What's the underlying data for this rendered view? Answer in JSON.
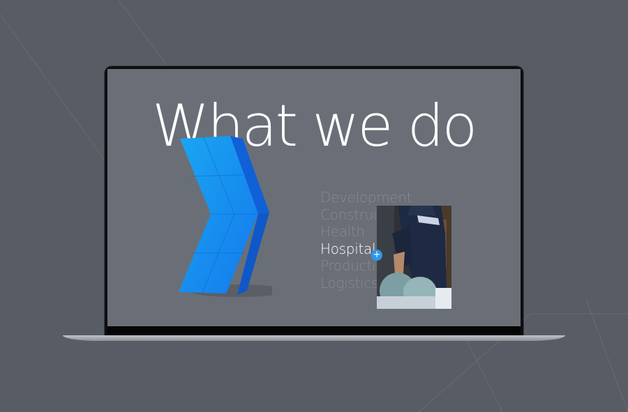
{
  "page": {
    "headline": "What we do",
    "services": [
      {
        "label": "Development",
        "active": false
      },
      {
        "label": "Construction",
        "active": false
      },
      {
        "label": "Health",
        "active": false
      },
      {
        "label": "Hospitality",
        "active": true
      },
      {
        "label": "Production",
        "active": false
      },
      {
        "label": "Logistics",
        "active": false
      }
    ],
    "cursor_symbol": "+"
  },
  "icons": {
    "logo": "chevron-arrow-icon",
    "cursor": "plus-icon"
  },
  "colors": {
    "background": "#585d65",
    "screen": "#6a6f77",
    "accent_blue": "#1a8ff0",
    "text_active": "#ffffff",
    "text_inactive": "#858a92"
  }
}
